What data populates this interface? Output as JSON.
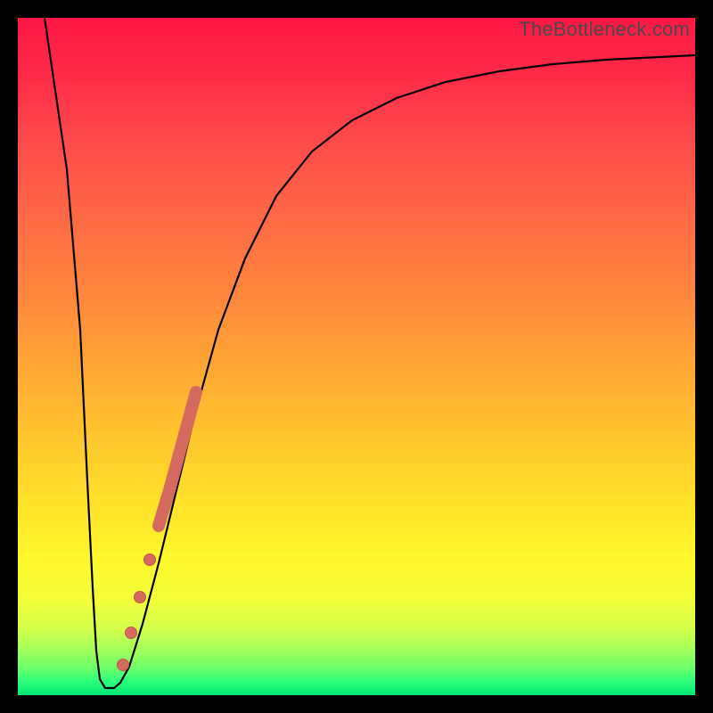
{
  "watermark": "TheBottleneck.com",
  "colors": {
    "curve": "#000000",
    "marker": "#d66a5e",
    "markerStroke": "#c2544a"
  },
  "chart_data": {
    "type": "line",
    "title": "",
    "xlabel": "",
    "ylabel": "",
    "xlim": [
      0,
      100
    ],
    "ylim": [
      0,
      100
    ],
    "grid": false,
    "legend": false,
    "background_gradient": [
      "#ff1744",
      "#ffc62e",
      "#fff82c",
      "#00e676"
    ],
    "x": [
      4,
      6,
      8,
      9,
      10,
      11,
      12,
      13,
      14,
      16,
      18,
      20,
      22,
      24,
      26,
      28,
      30,
      33,
      36,
      40,
      45,
      50,
      55,
      60,
      65,
      70,
      75,
      80,
      85,
      90,
      95,
      100
    ],
    "y": [
      100,
      78,
      46,
      22,
      4,
      1,
      1,
      2,
      4,
      8,
      14,
      22,
      30,
      38,
      46,
      53,
      59,
      65,
      70,
      75,
      79,
      82,
      85,
      87,
      88.5,
      89.8,
      90.8,
      91.6,
      92.2,
      92.7,
      93.1,
      93.4
    ],
    "markers": {
      "thick_segment": {
        "x": [
          20.5,
          24.5
        ],
        "y": [
          25,
          41
        ]
      },
      "dots": [
        {
          "x": 15.2,
          "y": 3.5
        },
        {
          "x": 16.3,
          "y": 8.5
        },
        {
          "x": 17.6,
          "y": 13.5
        },
        {
          "x": 18.9,
          "y": 19.0
        }
      ]
    }
  }
}
